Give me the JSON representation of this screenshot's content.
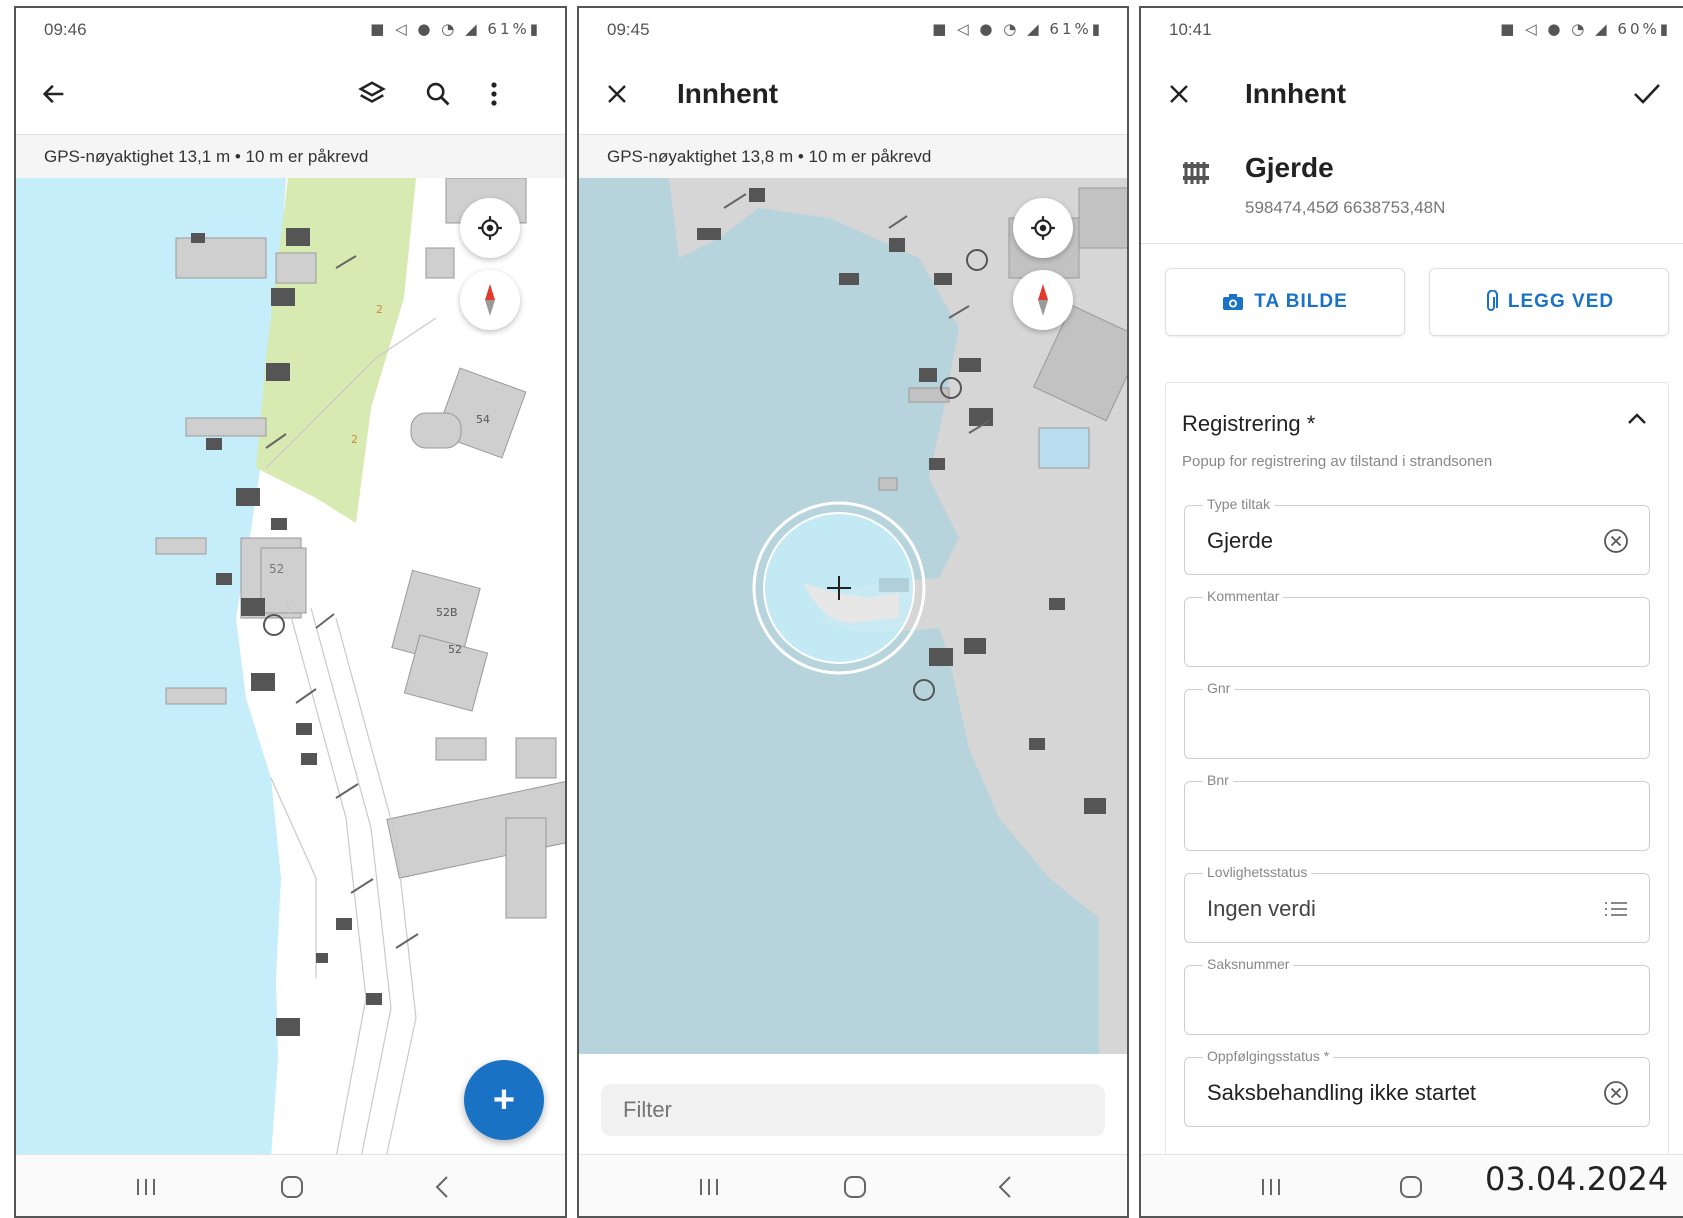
{
  "colors": {
    "water": "#c6eefa",
    "water_dim": "#b7d4dc",
    "land": "#ffffff",
    "land_dim": "#d6d6d6",
    "green": "#d6eab2",
    "building": "#cfcfcf",
    "accent": "#1a72c4"
  },
  "screen1": {
    "status": {
      "time": "09:46",
      "icons": "■ ◁ ● ◔ ◢ 61%▮"
    },
    "gps_text": "GPS-nøyaktighet 13,1 m  •  10 m er påkrevd",
    "map_labels": [
      "54",
      "52",
      "52B",
      "52",
      "2",
      "2"
    ],
    "fab_label": "+",
    "icons": {
      "back": "arrow-left-icon",
      "layers": "layers-icon",
      "search": "search-icon",
      "more": "more-vert-icon"
    }
  },
  "screen2": {
    "status": {
      "time": "09:45",
      "icons": "■ ◁ ● ◔ ◢ 61%▮"
    },
    "title": "Innhent",
    "gps_text": "GPS-nøyaktighet 13,8 m  •  10 m er påkrevd",
    "filter_placeholder": "Filter"
  },
  "screen3": {
    "status": {
      "time": "10:41",
      "icons": "■ ◁ ● ◔ ◢ 60%▮"
    },
    "title": "Innhent",
    "feature": {
      "name": "Gjerde",
      "coords": "598474,45Ø 6638753,48N"
    },
    "buttons": {
      "photo": "TA BILDE",
      "attach": "LEGG VED"
    },
    "section": {
      "title": "Registrering *",
      "subtitle": "Popup for registrering av tilstand i strandsonen",
      "fields": [
        {
          "label": "Type tiltak",
          "value": "Gjerde",
          "trail": "clear"
        },
        {
          "label": "Kommentar",
          "value": "",
          "trail": ""
        },
        {
          "label": "Gnr",
          "value": "",
          "trail": ""
        },
        {
          "label": "Bnr",
          "value": "",
          "trail": ""
        },
        {
          "label": "Lovlighetsstatus",
          "value": "Ingen verdi",
          "trail": "list"
        },
        {
          "label": "Saksnummer",
          "value": "",
          "trail": ""
        },
        {
          "label": "Oppfølgingsstatus *",
          "value": "Saksbehandling ikke startet",
          "trail": "clear"
        }
      ]
    }
  },
  "date_stamp": "03.04.2024"
}
